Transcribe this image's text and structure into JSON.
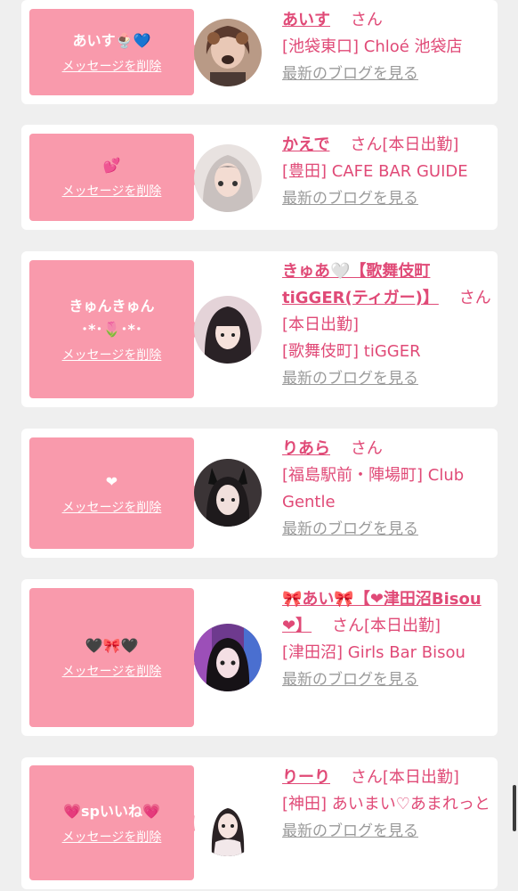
{
  "delete_label": "メッセージを削除",
  "blog_label": "最新のブログを見る",
  "san": "さん",
  "colors": {
    "bubble": "#f99aac",
    "text_pink": "#e04a77",
    "link_gray": "#9a9a9a",
    "page_bg": "#efefef"
  },
  "items": [
    {
      "message": "あいす🍨💙",
      "name": "あいす",
      "suffix": "",
      "shop": "[池袋東口] Chloé 池袋店"
    },
    {
      "message": "💕",
      "name": "かえで",
      "suffix": "[本日出勤]",
      "shop": "[豊田] CAFE BAR GUIDE"
    },
    {
      "message": "きゅんきゅん\n･*･🌷･*･",
      "name": "きゅあ🤍【歌舞伎町tiGGER(ティガー)】",
      "suffix": "[本日出勤]",
      "shop": "[歌舞伎町] tiGGER"
    },
    {
      "message": "❤",
      "name": "りあら",
      "suffix": "",
      "shop": "[福島駅前・陣場町] Club Gentle"
    },
    {
      "message": "🖤🎀🖤",
      "name": "🎀あい🎀【❤津田沼Bisou❤】",
      "suffix": "[本日出勤]",
      "shop": "[津田沼] Girls Bar Bisou"
    },
    {
      "message": "💗spいいね💗",
      "name": "りーり",
      "suffix": "[本日出勤]",
      "shop": "[神田] あいまい♡あまれっと"
    }
  ]
}
